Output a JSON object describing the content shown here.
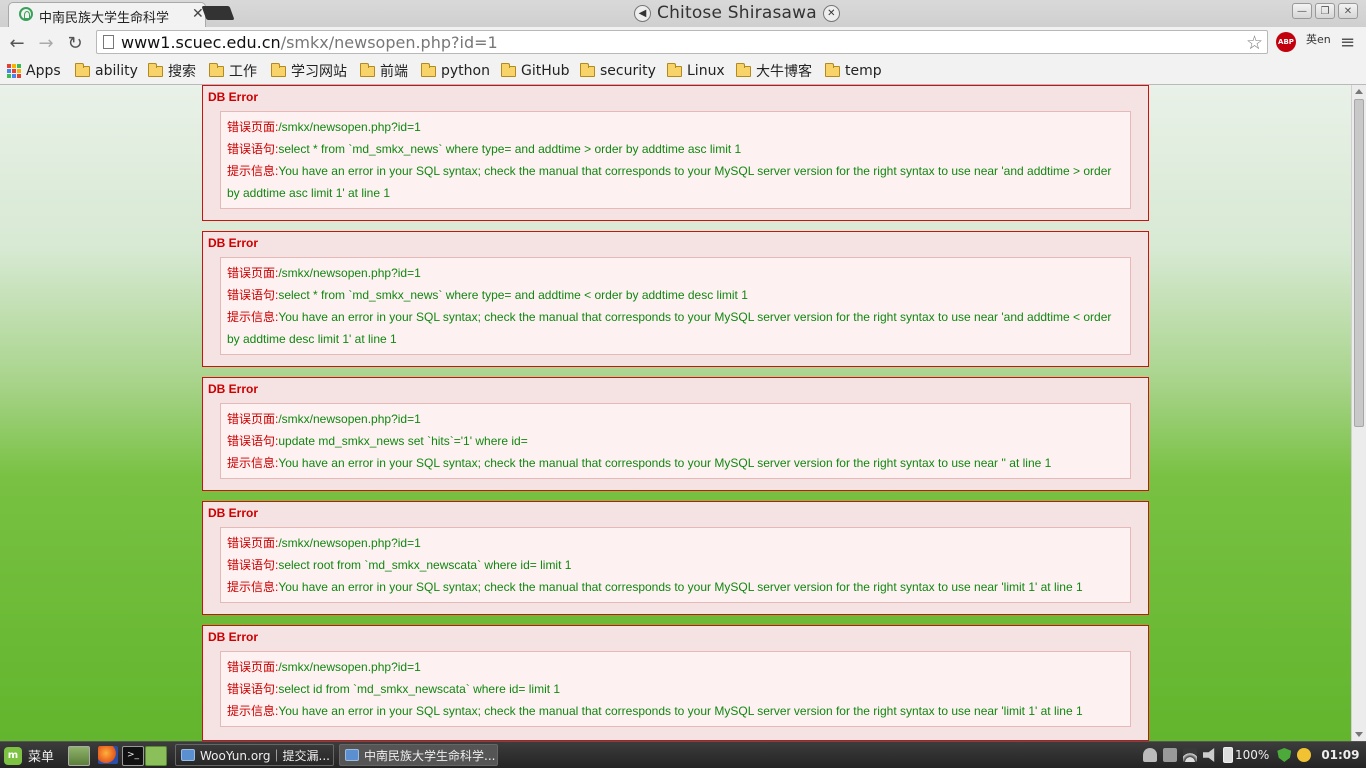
{
  "window": {
    "tab_title": "中南民族大学生命科学",
    "profile_name": "Chitose Shirasawa"
  },
  "address_bar": {
    "host": "www1.scuec.edu.cn",
    "path": "/smkx/newsopen.php?id=1"
  },
  "extensions": {
    "abp_label": "ABP",
    "translate_label": "英en"
  },
  "bookmarks": [
    {
      "label": "Apps",
      "kind": "apps"
    },
    {
      "label": "ability",
      "kind": "folder"
    },
    {
      "label": "搜索",
      "kind": "folder"
    },
    {
      "label": "工作",
      "kind": "folder"
    },
    {
      "label": "学习网站",
      "kind": "folder"
    },
    {
      "label": "前端",
      "kind": "folder"
    },
    {
      "label": "python",
      "kind": "folder"
    },
    {
      "label": "GitHub",
      "kind": "folder"
    },
    {
      "label": "security",
      "kind": "folder"
    },
    {
      "label": "Linux",
      "kind": "folder"
    },
    {
      "label": "大牛博客",
      "kind": "folder"
    },
    {
      "label": "temp",
      "kind": "folder"
    }
  ],
  "errors": [
    {
      "title": "DB Error",
      "page_label": "错误页面:",
      "page": "/smkx/newsopen.php?id=1",
      "stmt_label": "错误语句:",
      "stmt": "select * from `md_smkx_news` where type= and addtime > order by addtime asc limit 1",
      "msg_label": "提示信息:",
      "msg": "You have an error in your SQL syntax; check the manual that corresponds to your MySQL server version for the right syntax to use near 'and addtime > order by addtime asc limit 1' at line 1"
    },
    {
      "title": "DB Error",
      "page_label": "错误页面:",
      "page": "/smkx/newsopen.php?id=1",
      "stmt_label": "错误语句:",
      "stmt": "select * from `md_smkx_news` where type= and addtime < order by addtime desc limit 1",
      "msg_label": "提示信息:",
      "msg": "You have an error in your SQL syntax; check the manual that corresponds to your MySQL server version for the right syntax to use near 'and addtime < order by addtime desc limit 1' at line 1"
    },
    {
      "title": "DB Error",
      "page_label": "错误页面:",
      "page": "/smkx/newsopen.php?id=1",
      "stmt_label": "错误语句:",
      "stmt": "update md_smkx_news set `hits`='1' where id=",
      "msg_label": "提示信息:",
      "msg": "You have an error in your SQL syntax; check the manual that corresponds to your MySQL server version for the right syntax to use near '' at line 1"
    },
    {
      "title": "DB Error",
      "page_label": "错误页面:",
      "page": "/smkx/newsopen.php?id=1",
      "stmt_label": "错误语句:",
      "stmt": "select root from `md_smkx_newscata` where id= limit 1",
      "msg_label": "提示信息:",
      "msg": "You have an error in your SQL syntax; check the manual that corresponds to your MySQL server version for the right syntax to use near 'limit 1' at line 1"
    },
    {
      "title": "DB Error",
      "page_label": "错误页面:",
      "page": "/smkx/newsopen.php?id=1",
      "stmt_label": "错误语句:",
      "stmt": "select id from `md_smkx_newscata` where id= limit 1",
      "msg_label": "提示信息:",
      "msg": "You have an error in your SQL syntax; check the manual that corresponds to your MySQL server version for the right syntax to use near 'limit 1' at line 1"
    }
  ],
  "taskbar": {
    "menu_label": "菜单",
    "tasks": [
      {
        "label": "WooYun.org｜提交漏..."
      },
      {
        "label": "中南民族大学生命科学..."
      }
    ],
    "battery": "100%",
    "clock": "01:09"
  },
  "colors": {
    "error_border": "#cc1111",
    "error_label": "#cc0000",
    "error_value": "#118811",
    "page_green": "#62b52d"
  }
}
